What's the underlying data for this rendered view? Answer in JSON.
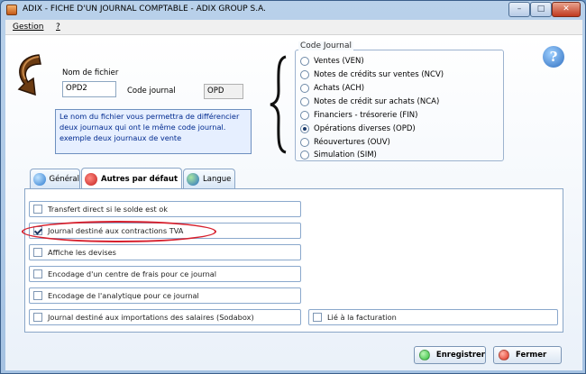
{
  "window": {
    "title": "ADIX - FICHE D'UN JOURNAL COMPTABLE - ADIX GROUP S.A.",
    "min_glyph": "–",
    "max_glyph": "□",
    "close_glyph": "✕"
  },
  "menu": {
    "items": [
      "Gestion",
      "?"
    ]
  },
  "form": {
    "nom_fichier_label": "Nom de fichier",
    "nom_fichier_value": "OPD2",
    "code_journal_label": "Code journal",
    "code_journal_value": "OPD",
    "info_text": [
      "Le nom du fichier vous permettra de différencier",
      "deux journaux qui ont le même code journal.",
      "exemple deux journaux de vente"
    ]
  },
  "code_journal_group": {
    "legend": "Code Journal",
    "options": [
      "Ventes (VEN)",
      "Notes de crédits sur ventes (NCV)",
      "Achats (ACH)",
      "Notes de crédit sur achats (NCA)",
      "Financiers - trésorerie (FIN)",
      "Opérations diverses (OPD)",
      "Réouvertures (OUV)",
      "Simulation (SIM)"
    ],
    "selected_index": 5
  },
  "tabs": [
    {
      "label": "Général",
      "icon": "globe-icon"
    },
    {
      "label": "Autres par défaut",
      "icon": "no-entry-icon",
      "active": true
    },
    {
      "label": "Langue",
      "icon": "earth-icon"
    }
  ],
  "options": [
    {
      "label": "Transfert direct si le solde est ok",
      "checked": false
    },
    {
      "label": "Journal destiné aux contractions TVA",
      "checked": true
    },
    {
      "label": "Affiche les devises",
      "checked": false
    },
    {
      "label": "Encodage d'un centre de frais pour ce journal",
      "checked": false
    },
    {
      "label": "Encodage de l'analytique pour ce journal",
      "checked": false
    },
    {
      "label": "Journal destiné aux importations des salaires (Sodabox)",
      "checked": false
    },
    {
      "label": "Lié à la facturation",
      "checked": false
    }
  ],
  "buttons": {
    "save_label": "Enregistrer",
    "close_label": "Fermer"
  },
  "colors": {
    "accent_highlight": "#d7202d",
    "save_dot": "#2fbf3a",
    "close_dot": "#e0301e",
    "info_text": "#002a8f"
  }
}
